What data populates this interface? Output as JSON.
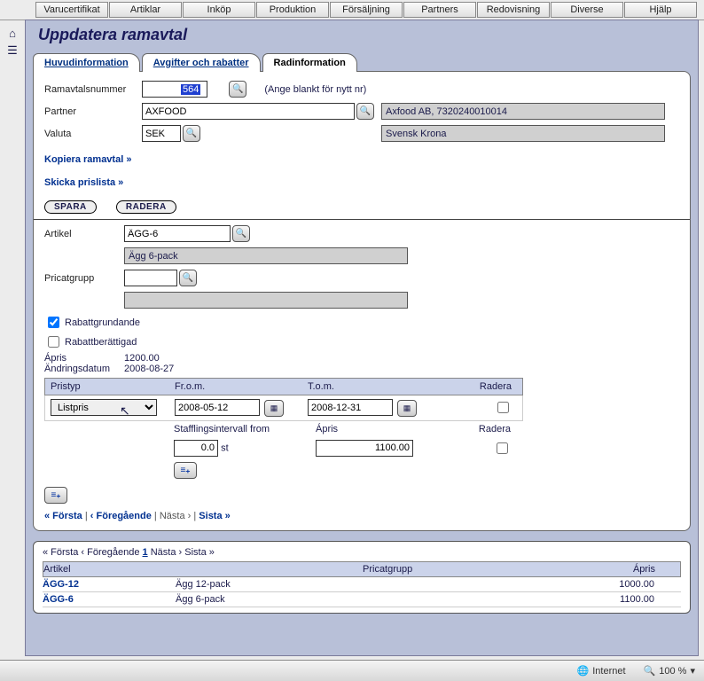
{
  "menubar": [
    "Varucertifikat",
    "Artiklar",
    "Inköp",
    "Produktion",
    "Försäljning",
    "Partners",
    "Redovisning",
    "Diverse",
    "Hjälp"
  ],
  "page_title": "Uppdatera ramavtal",
  "tabs": {
    "t1": "Huvudinformation",
    "t2": "Avgifter och rabatter",
    "t3": "Radinformation"
  },
  "form": {
    "ramavtal_label": "Ramavtalsnummer",
    "ramavtal_value": "564",
    "ramavtal_hint": "(Ange blankt för nytt nr)",
    "partner_label": "Partner",
    "partner_value": "AXFOOD",
    "partner_readout": "Axfood AB, 7320240010014",
    "valuta_label": "Valuta",
    "valuta_value": "SEK",
    "valuta_readout": "Svensk Krona"
  },
  "links": {
    "copy": "Kopiera ramavtal »",
    "send": "Skicka prislista »"
  },
  "buttons": {
    "save": "SPARA",
    "delete": "RADERA"
  },
  "article": {
    "label": "Artikel",
    "value": "ÄGG-6",
    "desc": "Ägg 6-pack",
    "pricat_label": "Pricatgrupp",
    "pricat_value": "",
    "pricat_desc": "",
    "cb1": "Rabattgrundande",
    "cb2": "Rabattberättigad",
    "apris_label": "Ápris",
    "apris_value": "1200.00",
    "changed_label": "Ändringsdatum",
    "changed_value": "2008-08-27"
  },
  "pricegrid": {
    "h1": "Pristyp",
    "h2": "Fr.o.m.",
    "h3": "T.o.m.",
    "h4": "Radera",
    "type": "Listpris",
    "from": "2008-05-12",
    "to": "2008-12-31",
    "sh1": "Stafflingsintervall from",
    "sh2": "Ápris",
    "sh3": "Radera",
    "qty": "0.0",
    "unit": "st",
    "price": "1100.00"
  },
  "pager": {
    "first": "« Första",
    "prev": "‹ Föregående",
    "next": "Nästa ›",
    "last": "Sista »"
  },
  "listpager": {
    "first": "« Första",
    "prev": "‹ Föregående",
    "page": "1",
    "next": "Nästa ›",
    "last": "Sista »"
  },
  "listheader": {
    "c1": "Artikel",
    "c2": "",
    "c3": "Pricatgrupp",
    "c4": "Ápris"
  },
  "rows": [
    {
      "code": "ÄGG-12",
      "desc": "Ägg 12-pack",
      "grp": "",
      "apris": "1000.00"
    },
    {
      "code": "ÄGG-6",
      "desc": "Ägg 6-pack",
      "grp": "",
      "apris": "1100.00"
    }
  ],
  "status": {
    "zone": "Internet",
    "zoom": "100 %"
  }
}
